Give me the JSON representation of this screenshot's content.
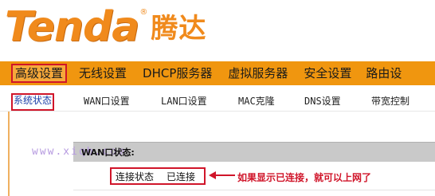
{
  "brand": {
    "logo_latin": "Tenda",
    "logo_reg": "®",
    "logo_cn": "腾达",
    "color": "#f08a1c"
  },
  "main_nav": {
    "background": "#f0960f",
    "items": [
      {
        "label": "高级设置",
        "active": true
      },
      {
        "label": "无线设置",
        "active": false
      },
      {
        "label": "DHCP服务器",
        "active": false
      },
      {
        "label": "虚拟服务器",
        "active": false
      },
      {
        "label": "安全设置",
        "active": false
      },
      {
        "label": "路由设",
        "active": false
      }
    ]
  },
  "sub_nav": {
    "items": [
      {
        "label": "系统状态",
        "active": true
      },
      {
        "label": "WAN口设置",
        "active": false
      },
      {
        "label": "LAN口设置",
        "active": false
      },
      {
        "label": "MAC克隆",
        "active": false
      },
      {
        "label": "DNS设置",
        "active": false
      },
      {
        "label": "带宽控制",
        "active": false
      }
    ]
  },
  "content": {
    "watermark": "www.xiqb.com",
    "section_title": "WAN口状态:",
    "status": {
      "label": "连接状态",
      "value": "已连接"
    },
    "annotation": "如果显示已连接，就可以上网了",
    "highlight_color": "#d0152a"
  }
}
